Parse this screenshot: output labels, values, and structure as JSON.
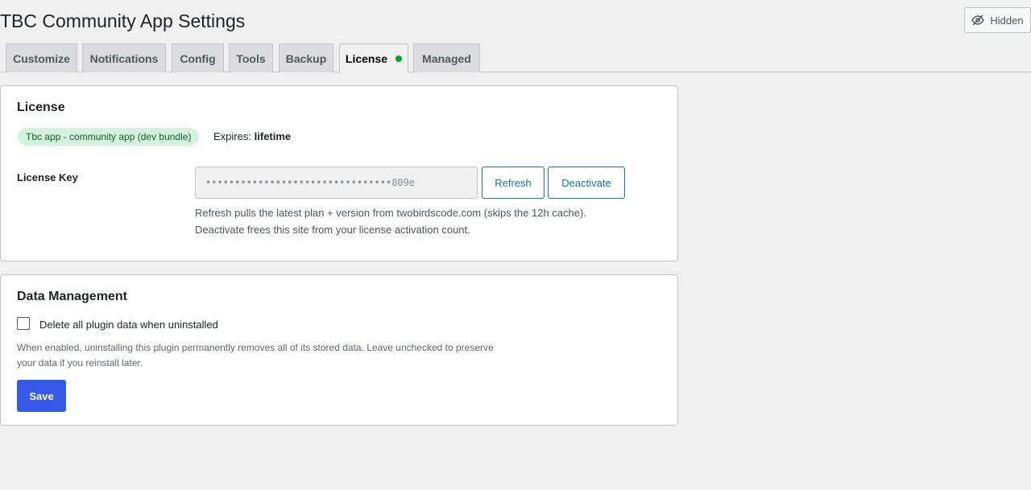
{
  "page": {
    "title": "TBC Community App Settings",
    "hidden_button_label": "Hidden"
  },
  "tabs": [
    {
      "label": "Customize",
      "active": false
    },
    {
      "label": "Notifications",
      "active": false
    },
    {
      "label": "Config",
      "active": false
    },
    {
      "label": "Tools",
      "active": false
    },
    {
      "label": "Backup",
      "active": false
    },
    {
      "label": "License",
      "active": true,
      "status_dot": "green"
    },
    {
      "label": "Managed",
      "active": false
    }
  ],
  "license": {
    "heading": "License",
    "plan_badge": "Tbc app - community app (dev bundle)",
    "expires_label": "Expires:",
    "expires_value": "lifetime",
    "key_label": "License Key",
    "key_value": "••••••••••••••••••••••••••••••••809e",
    "refresh_label": "Refresh",
    "deactivate_label": "Deactivate",
    "help_line1": "Refresh pulls the latest plan + version from twobirdscode.com (skips the 12h cache).",
    "help_line2": "Deactivate frees this site from your license activation count."
  },
  "data_management": {
    "heading": "Data Management",
    "checkbox_label": "Delete all plugin data when uninstalled",
    "checkbox_checked": false,
    "description_line1": "When enabled, uninstalling this plugin permanently removes all of its stored data. Leave unchecked to preserve",
    "description_line2": "your data if you reinstall later.",
    "save_label": "Save"
  },
  "colors": {
    "background": "#f0f0f1",
    "accent": "#2271b1",
    "save_button": "#3858e9",
    "badge_bg": "#d4f3dc",
    "status_dot": "#00a32a"
  }
}
